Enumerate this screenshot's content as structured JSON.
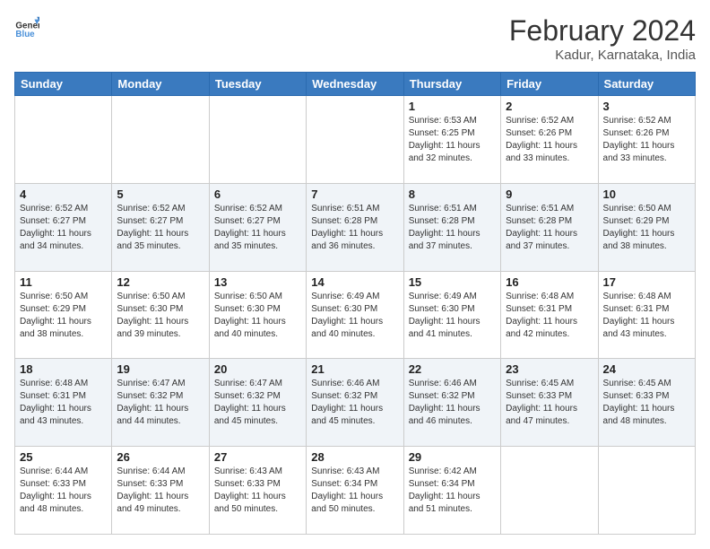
{
  "header": {
    "logo_general": "General",
    "logo_blue": "Blue",
    "month_title": "February 2024",
    "location": "Kadur, Karnataka, India"
  },
  "days_of_week": [
    "Sunday",
    "Monday",
    "Tuesday",
    "Wednesday",
    "Thursday",
    "Friday",
    "Saturday"
  ],
  "weeks": [
    [
      {
        "day": "",
        "info": ""
      },
      {
        "day": "",
        "info": ""
      },
      {
        "day": "",
        "info": ""
      },
      {
        "day": "",
        "info": ""
      },
      {
        "day": "1",
        "info": "Sunrise: 6:53 AM\nSunset: 6:25 PM\nDaylight: 11 hours and 32 minutes."
      },
      {
        "day": "2",
        "info": "Sunrise: 6:52 AM\nSunset: 6:26 PM\nDaylight: 11 hours and 33 minutes."
      },
      {
        "day": "3",
        "info": "Sunrise: 6:52 AM\nSunset: 6:26 PM\nDaylight: 11 hours and 33 minutes."
      }
    ],
    [
      {
        "day": "4",
        "info": "Sunrise: 6:52 AM\nSunset: 6:27 PM\nDaylight: 11 hours and 34 minutes."
      },
      {
        "day": "5",
        "info": "Sunrise: 6:52 AM\nSunset: 6:27 PM\nDaylight: 11 hours and 35 minutes."
      },
      {
        "day": "6",
        "info": "Sunrise: 6:52 AM\nSunset: 6:27 PM\nDaylight: 11 hours and 35 minutes."
      },
      {
        "day": "7",
        "info": "Sunrise: 6:51 AM\nSunset: 6:28 PM\nDaylight: 11 hours and 36 minutes."
      },
      {
        "day": "8",
        "info": "Sunrise: 6:51 AM\nSunset: 6:28 PM\nDaylight: 11 hours and 37 minutes."
      },
      {
        "day": "9",
        "info": "Sunrise: 6:51 AM\nSunset: 6:28 PM\nDaylight: 11 hours and 37 minutes."
      },
      {
        "day": "10",
        "info": "Sunrise: 6:50 AM\nSunset: 6:29 PM\nDaylight: 11 hours and 38 minutes."
      }
    ],
    [
      {
        "day": "11",
        "info": "Sunrise: 6:50 AM\nSunset: 6:29 PM\nDaylight: 11 hours and 38 minutes."
      },
      {
        "day": "12",
        "info": "Sunrise: 6:50 AM\nSunset: 6:30 PM\nDaylight: 11 hours and 39 minutes."
      },
      {
        "day": "13",
        "info": "Sunrise: 6:50 AM\nSunset: 6:30 PM\nDaylight: 11 hours and 40 minutes."
      },
      {
        "day": "14",
        "info": "Sunrise: 6:49 AM\nSunset: 6:30 PM\nDaylight: 11 hours and 40 minutes."
      },
      {
        "day": "15",
        "info": "Sunrise: 6:49 AM\nSunset: 6:30 PM\nDaylight: 11 hours and 41 minutes."
      },
      {
        "day": "16",
        "info": "Sunrise: 6:48 AM\nSunset: 6:31 PM\nDaylight: 11 hours and 42 minutes."
      },
      {
        "day": "17",
        "info": "Sunrise: 6:48 AM\nSunset: 6:31 PM\nDaylight: 11 hours and 43 minutes."
      }
    ],
    [
      {
        "day": "18",
        "info": "Sunrise: 6:48 AM\nSunset: 6:31 PM\nDaylight: 11 hours and 43 minutes."
      },
      {
        "day": "19",
        "info": "Sunrise: 6:47 AM\nSunset: 6:32 PM\nDaylight: 11 hours and 44 minutes."
      },
      {
        "day": "20",
        "info": "Sunrise: 6:47 AM\nSunset: 6:32 PM\nDaylight: 11 hours and 45 minutes."
      },
      {
        "day": "21",
        "info": "Sunrise: 6:46 AM\nSunset: 6:32 PM\nDaylight: 11 hours and 45 minutes."
      },
      {
        "day": "22",
        "info": "Sunrise: 6:46 AM\nSunset: 6:32 PM\nDaylight: 11 hours and 46 minutes."
      },
      {
        "day": "23",
        "info": "Sunrise: 6:45 AM\nSunset: 6:33 PM\nDaylight: 11 hours and 47 minutes."
      },
      {
        "day": "24",
        "info": "Sunrise: 6:45 AM\nSunset: 6:33 PM\nDaylight: 11 hours and 48 minutes."
      }
    ],
    [
      {
        "day": "25",
        "info": "Sunrise: 6:44 AM\nSunset: 6:33 PM\nDaylight: 11 hours and 48 minutes."
      },
      {
        "day": "26",
        "info": "Sunrise: 6:44 AM\nSunset: 6:33 PM\nDaylight: 11 hours and 49 minutes."
      },
      {
        "day": "27",
        "info": "Sunrise: 6:43 AM\nSunset: 6:33 PM\nDaylight: 11 hours and 50 minutes."
      },
      {
        "day": "28",
        "info": "Sunrise: 6:43 AM\nSunset: 6:34 PM\nDaylight: 11 hours and 50 minutes."
      },
      {
        "day": "29",
        "info": "Sunrise: 6:42 AM\nSunset: 6:34 PM\nDaylight: 11 hours and 51 minutes."
      },
      {
        "day": "",
        "info": ""
      },
      {
        "day": "",
        "info": ""
      }
    ]
  ]
}
